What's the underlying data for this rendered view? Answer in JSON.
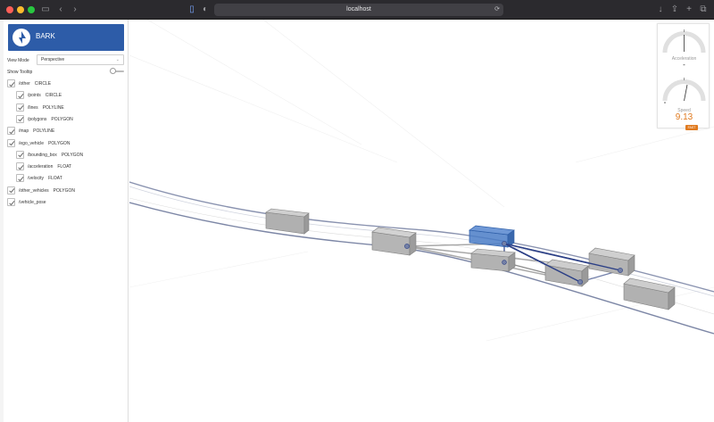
{
  "browser": {
    "address": "localhost"
  },
  "app": {
    "brand": "BARK"
  },
  "controls": {
    "view_mode_label": "View Mode",
    "view_mode_value": "Perspective",
    "tooltip_label": "Show Tooltip",
    "tooltip_on": false
  },
  "layers": [
    {
      "name": "/other",
      "type": "CIRCLE",
      "indent": 0,
      "checked": true
    },
    {
      "name": "/points",
      "type": "CIRCLE",
      "indent": 1,
      "checked": true
    },
    {
      "name": "/lines",
      "type": "POLYLINE",
      "indent": 1,
      "checked": true
    },
    {
      "name": "/polygons",
      "type": "POLYGON",
      "indent": 1,
      "checked": true
    },
    {
      "name": "/map",
      "type": "POLYLINE",
      "indent": 0,
      "checked": true
    },
    {
      "name": "/ego_vehicle",
      "type": "POLYGON",
      "indent": 0,
      "checked": true
    },
    {
      "name": "/bounding_box",
      "type": "POLYGON",
      "indent": 1,
      "checked": true
    },
    {
      "name": "/acceleration",
      "type": "FLOAT",
      "indent": 1,
      "checked": true
    },
    {
      "name": "/velocity",
      "type": "FLOAT",
      "indent": 1,
      "checked": true
    },
    {
      "name": "/other_vehicles",
      "type": "POLYGON",
      "indent": 0,
      "checked": true
    },
    {
      "name": "/vehicle_pose",
      "type": "",
      "indent": 0,
      "checked": true
    }
  ],
  "gauges": {
    "acceleration_label": "Acceleration",
    "acceleration_value": "-",
    "speed_label": "Speed",
    "speed_value": "9.13",
    "speed_badge": "FAST"
  },
  "colors": {
    "brand": "#2d5ca8",
    "ego_vehicle": "#4a7cc7",
    "links": "#2b3f86",
    "speed": "#e07a1f"
  }
}
